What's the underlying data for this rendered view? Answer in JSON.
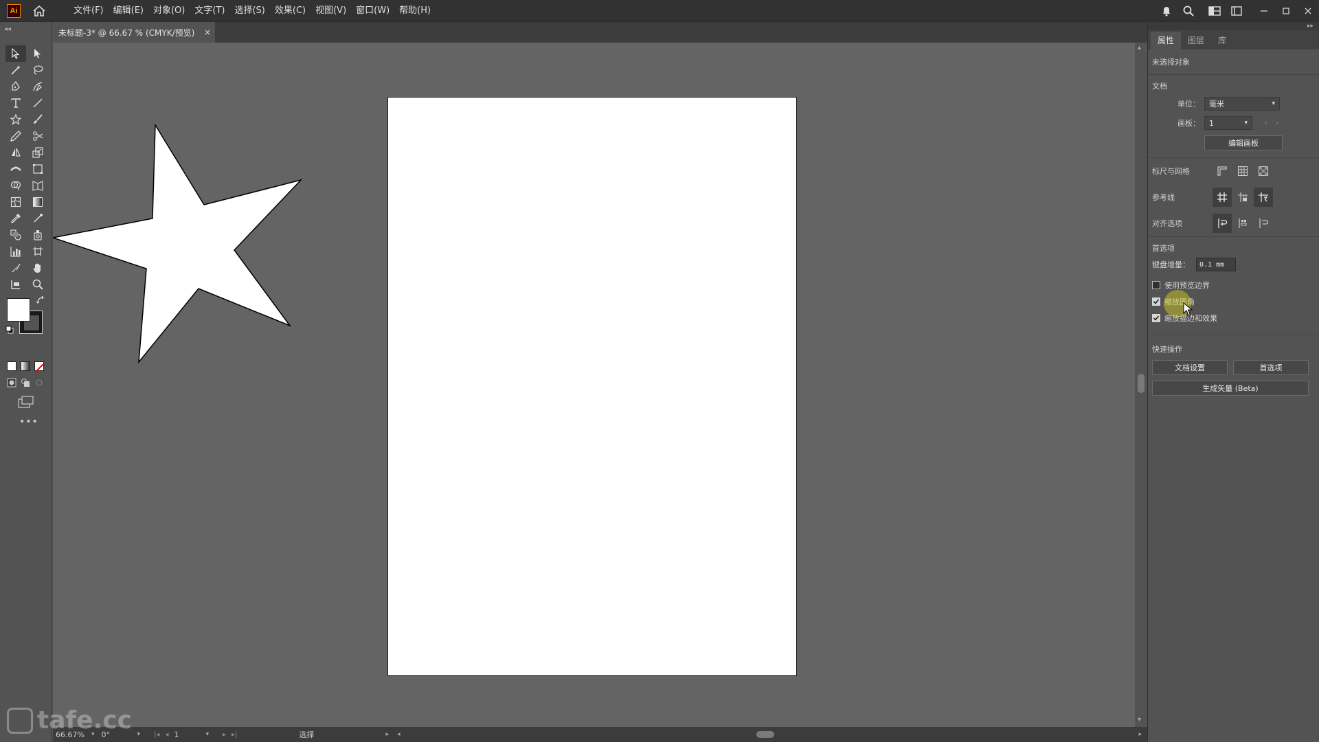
{
  "app": {
    "logo_text": "Ai"
  },
  "menu": {
    "items": [
      "文件(F)",
      "编辑(E)",
      "对象(O)",
      "文字(T)",
      "选择(S)",
      "效果(C)",
      "视图(V)",
      "窗口(W)",
      "帮助(H)"
    ]
  },
  "document": {
    "tab_title": "未标题-3* @ 66.67 % (CMYK/预览)",
    "close_glyph": "×"
  },
  "status": {
    "zoom": "66.67%",
    "angle": "0°",
    "artboard_number": "1",
    "tool_status": "选择"
  },
  "watermark": {
    "text": "tafe.cc"
  },
  "panel": {
    "tabs": [
      "属性",
      "图层",
      "库"
    ],
    "no_selection": "未选择对象",
    "document_section": {
      "title": "文档",
      "units_label": "单位：",
      "units_value": "毫米",
      "artboard_label": "画板：",
      "artboard_value": "1",
      "edit_artboards_button": "编辑画板"
    },
    "rulers_grids_title": "标尺与网格",
    "guides_title": "参考线",
    "snap_options_title": "对齐选项",
    "preferences_section": {
      "title": "首选项",
      "keyboard_increment_label": "键盘增量：",
      "keyboard_increment_value": "0.1 mm",
      "checkboxes": [
        {
          "label": "使用预览边界",
          "checked": false
        },
        {
          "label": "缩放圆角",
          "checked": true
        },
        {
          "label": "缩放描边和效果",
          "checked": true
        }
      ]
    },
    "quick_actions": {
      "title": "快速操作",
      "document_setup_button": "文档设置",
      "preferences_button": "首选项",
      "generate_vectors_button": "生成矢量 (Beta)"
    }
  },
  "colors": {
    "menubar_bg": "#323232",
    "ui_bg": "#535353",
    "canvas_bg": "#646464",
    "artboard": "#ffffff",
    "star_fill": "#ffffff",
    "star_stroke": "#000000",
    "cursor_highlight": "#dcd21e"
  }
}
